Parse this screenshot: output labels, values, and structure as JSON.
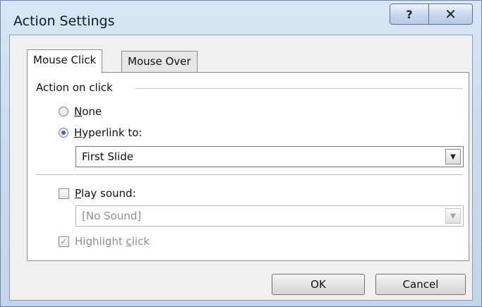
{
  "window": {
    "title": "Action Settings",
    "help_label": "?",
    "close_label": "✕"
  },
  "tabs": [
    {
      "label": "Mouse Click",
      "active": true
    },
    {
      "label": "Mouse Over",
      "active": false
    }
  ],
  "action_group": {
    "label": "Action on click",
    "none_prefix": "N",
    "none_rest": "one",
    "hyperlink_prefix": "H",
    "hyperlink_rest": "yperlink to:",
    "selected_option": "Hyperlink to:",
    "hyperlink_value": "First Slide"
  },
  "sound": {
    "prefix": "P",
    "rest": "lay sound:",
    "checked": false,
    "value": "[No Sound]"
  },
  "highlight": {
    "label_start": "Highlight ",
    "label_u": "c",
    "label_end": "lick",
    "checked": true,
    "check_glyph": "✓"
  },
  "buttons": {
    "ok": "OK",
    "cancel": "Cancel"
  },
  "icons": {
    "dropdown_arrow": "▼"
  }
}
